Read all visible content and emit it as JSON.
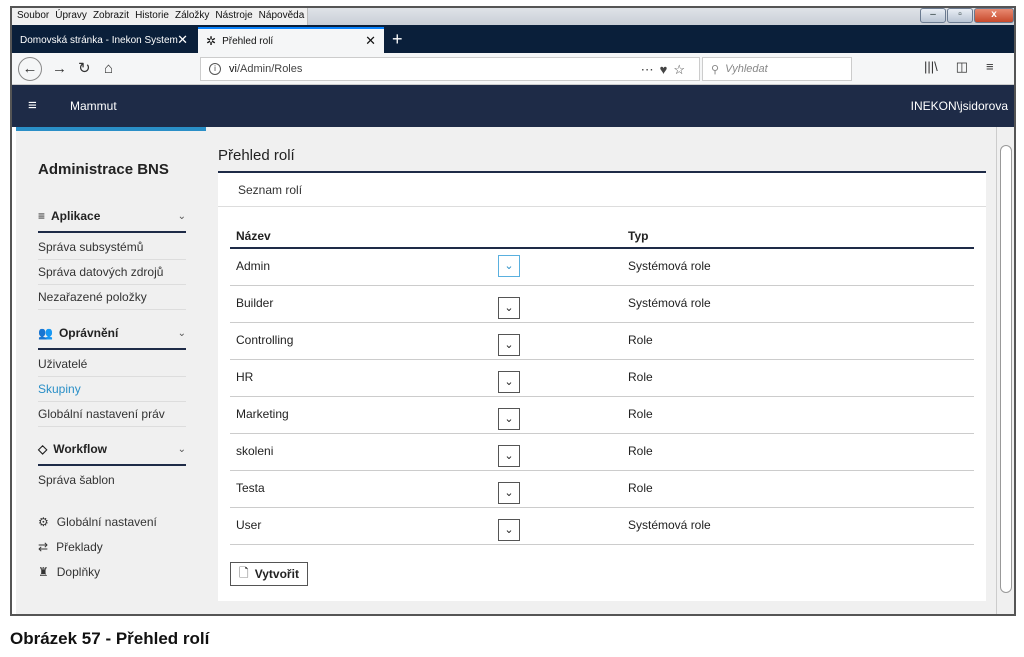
{
  "menubar": [
    "Soubor",
    "Úpravy",
    "Zobrazit",
    "Historie",
    "Záložky",
    "Nástroje",
    "Nápověda"
  ],
  "tabs": [
    {
      "label": "Domovská stránka - Inekon System"
    },
    {
      "label": "Přehled rolí"
    }
  ],
  "url": {
    "prefix": "vi",
    "path": "/Admin/Roles"
  },
  "search": {
    "placeholder": "Vyhledat"
  },
  "app": {
    "name": "Mammut",
    "user": "INEKON\\jsidorova"
  },
  "sidebar": {
    "title": "Administrace BNS",
    "groups": [
      {
        "label": "Aplikace",
        "items": [
          "Správa subsystémů",
          "Správa datových zdrojů",
          "Nezařazené položky"
        ]
      },
      {
        "label": "Oprávnění",
        "items": [
          "Uživatelé",
          "Skupiny",
          "Globální nastavení práv"
        ]
      },
      {
        "label": "Workflow",
        "items": [
          "Správa šablon"
        ]
      }
    ],
    "footer": [
      "Globální nastavení",
      "Překlady",
      "Doplňky"
    ]
  },
  "main": {
    "page_title": "Přehled rolí",
    "card_title": "Seznam rolí",
    "columns": [
      "Název",
      "Typ"
    ],
    "rows": [
      {
        "name": "Admin",
        "type": "Systémová role"
      },
      {
        "name": "Builder",
        "type": "Systémová role"
      },
      {
        "name": "Controlling",
        "type": "Role"
      },
      {
        "name": "HR",
        "type": "Role"
      },
      {
        "name": "Marketing",
        "type": "Role"
      },
      {
        "name": "skoleni",
        "type": "Role"
      },
      {
        "name": "Testa",
        "type": "Role"
      },
      {
        "name": "User",
        "type": "Systémová role"
      }
    ],
    "create_label": "Vytvořit"
  },
  "caption": "Obrázek 57 - Přehled rolí",
  "colors": {
    "header": "#1e2b47",
    "accent": "#2a8fc7"
  }
}
